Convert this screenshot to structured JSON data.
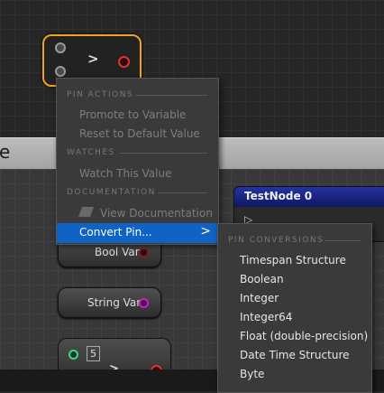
{
  "panel": {
    "header_text": "e"
  },
  "graph": {
    "reroute_node": {
      "exec_glyph": ">"
    },
    "bool_var": {
      "label": "Bool Var"
    },
    "string_var": {
      "label": "String Var"
    },
    "bottom_node": {
      "value": "5",
      "exec_glyph": ">"
    },
    "test_node": {
      "title": "TestNode 0",
      "exec_glyph": "▷"
    }
  },
  "context_menu": {
    "sections": {
      "pin_actions": "PIN ACTIONS",
      "watches": "WATCHES",
      "documentation": "DOCUMENTATION"
    },
    "items": {
      "promote": "Promote to Variable",
      "reset": "Reset to Default Value",
      "watch": "Watch This Value",
      "view_doc": "View Documentation",
      "convert": "Convert Pin..."
    },
    "chevron": ">"
  },
  "submenu": {
    "section": "PIN CONVERSIONS",
    "items": [
      "Timespan Structure",
      "Boolean",
      "Integer",
      "Integer64",
      "Float (double-precision)",
      "Date Time Structure",
      "Byte"
    ]
  },
  "colors": {
    "selection_outline": "#f0a31c",
    "menu_highlight": "#0f63c4",
    "string_pin": "#d31bd8",
    "int_pin": "#3fd48a",
    "exec_pin_red": "#e53030",
    "test_node_title": "#2533a0"
  }
}
